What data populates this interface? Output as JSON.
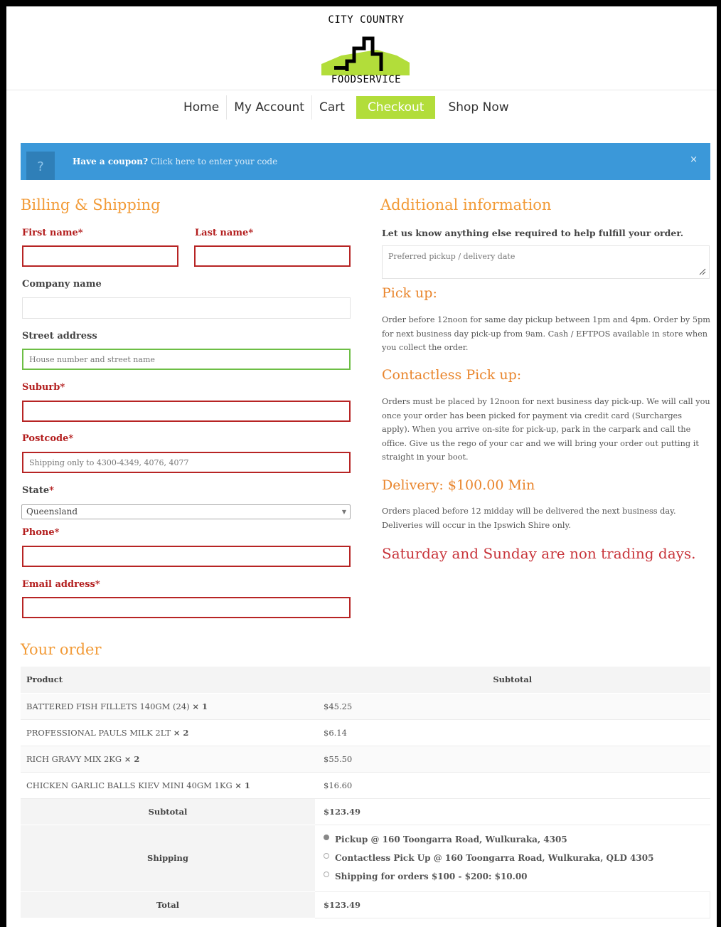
{
  "logo": {
    "top_text": "CITY COUNTRY",
    "bottom_text": "FOODSERVICE"
  },
  "nav": [
    {
      "label": "Home",
      "active": false
    },
    {
      "label": "My Account",
      "active": false
    },
    {
      "label": "Cart",
      "active": false
    },
    {
      "label": "Checkout",
      "active": true
    },
    {
      "label": "Shop Now",
      "active": false
    }
  ],
  "coupon": {
    "icon": "?",
    "bold": "Have a coupon?",
    "link": "Click here to enter your code",
    "close": "×"
  },
  "billing": {
    "title": "Billing & Shipping",
    "first_name": "First name",
    "last_name": "Last name",
    "company": "Company name",
    "street": "Street address",
    "street_placeholder": "House number and street name",
    "suburb": "Suburb",
    "postcode": "Postcode",
    "postcode_placeholder": "Shipping only to 4300-4349, 4076, 4077",
    "state": "State",
    "state_value": "Queensland",
    "phone": "Phone",
    "email": "Email address",
    "required_mark": "*"
  },
  "additional": {
    "title": "Additional information",
    "notes_label": "Let us know anything else required to help fulfill your order.",
    "notes_placeholder": "Preferred pickup / delivery date",
    "pickup_title": "Pick up:",
    "pickup_text": "Order before 12noon for same day pickup between 1pm and 4pm. Order by 5pm for next business day pick-up from 9am. Cash / EFTPOS available in store when you collect the order.",
    "contactless_title": "Contactless Pick up:",
    "contactless_text": "Orders must be placed by 12noon for next business day pick-up. We will call you once your order has been picked for payment via credit card (Surcharges apply). When you arrive on-site for pick-up, park in the carpark and call the office. Give us the rego of your car and we will bring your order out putting it straight in your boot.",
    "delivery_title": "Delivery: $100.00 Min",
    "delivery_text": "Orders placed before 12 midday will be delivered the next business day. Deliveries will occur in the Ipswich Shire only.",
    "closed_notice": "Saturday and Sunday are non trading days."
  },
  "order": {
    "title": "Your order",
    "col_product": "Product",
    "col_subtotal": "Subtotal",
    "items": [
      {
        "name": "BATTERED FISH FILLETS 140GM (24)",
        "qty": "× 1",
        "price": "$45.25"
      },
      {
        "name": "PROFESSIONAL PAULS MILK 2LT",
        "qty": "× 2",
        "price": "$6.14"
      },
      {
        "name": "RICH GRAVY MIX 2KG",
        "qty": "× 2",
        "price": "$55.50"
      },
      {
        "name": "CHICKEN GARLIC BALLS KIEV MINI 40GM 1KG",
        "qty": "× 1",
        "price": "$16.60"
      }
    ],
    "subtotal_label": "Subtotal",
    "subtotal_value": "$123.49",
    "shipping_label": "Shipping",
    "shipping_options": [
      "Pickup @ 160 Toongarra Road, Wulkuraka, 4305",
      "Contactless Pick Up @ 160 Toongarra Road, Wulkuraka, QLD 4305",
      "Shipping for orders $100 - $200: $10.00"
    ],
    "total_label": "Total",
    "total_value": "$123.49"
  },
  "colors": {
    "accent_orange": "#f29b38",
    "nav_active": "#b2dd3a",
    "error_red": "#b72424",
    "info_blue": "#3b98d9"
  }
}
